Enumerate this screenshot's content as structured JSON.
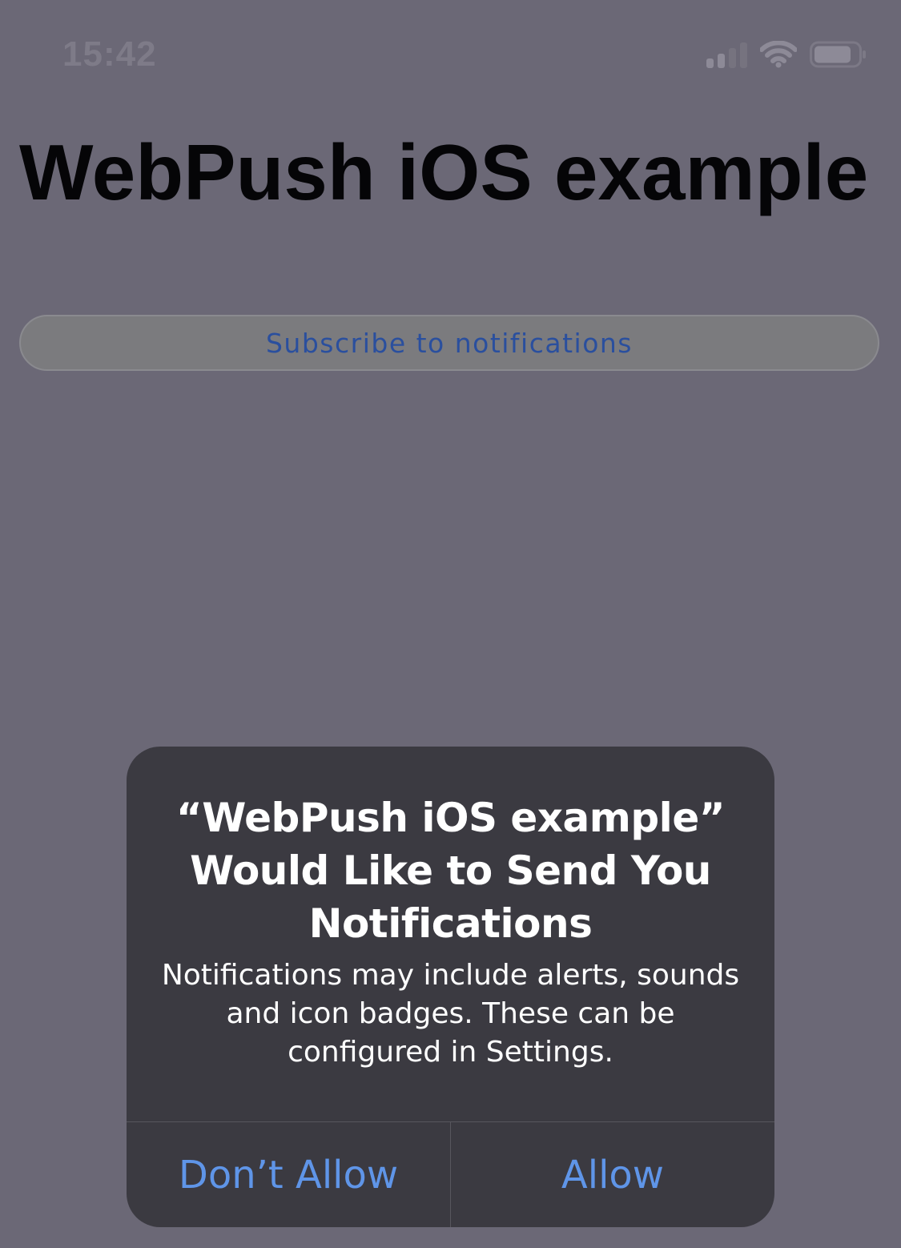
{
  "status_bar": {
    "time": "15:42",
    "icons": [
      "signal-icon",
      "wifi-icon",
      "battery-icon"
    ]
  },
  "page": {
    "title": "WebPush iOS example",
    "subscribe_label": "Subscribe to notifications"
  },
  "alert": {
    "title": "“WebPush iOS example” Would Like to Send You Notifications",
    "message": "Notifications may include alerts, sounds and icon badges. These can be configured in Settings.",
    "deny_label": "Don’t Allow",
    "allow_label": "Allow"
  },
  "colors": {
    "background": "#6b6876",
    "alert_background": "#3b3a41",
    "action_blue": "#5f95e8",
    "link_blue": "#2a4f9e"
  }
}
